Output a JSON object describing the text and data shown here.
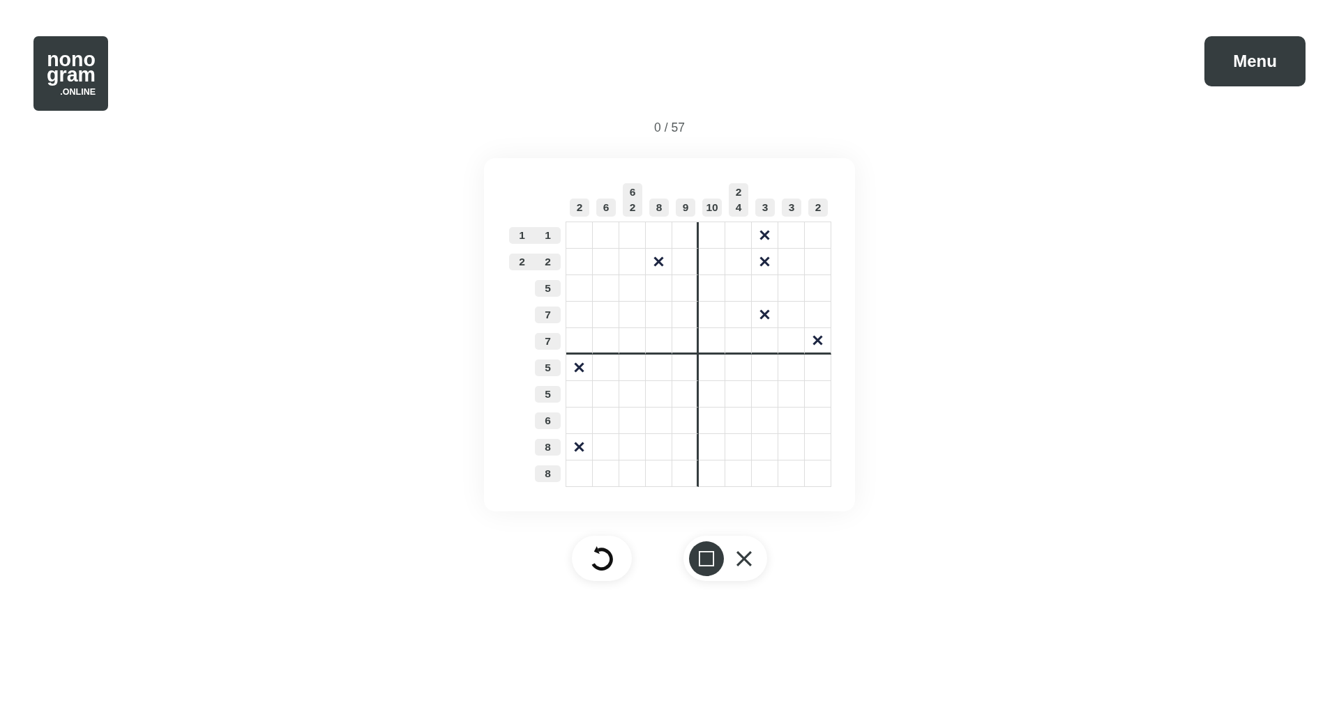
{
  "logo": {
    "wordmark": [
      "nono",
      "gram"
    ],
    "suffix": ".ONLINE"
  },
  "menu_button": {
    "label": "Menu"
  },
  "progress": "0 / 57",
  "puzzle": {
    "columns": [
      {
        "clues": [
          "2"
        ]
      },
      {
        "clues": [
          "6"
        ]
      },
      {
        "clues": [
          "6",
          "2"
        ]
      },
      {
        "clues": [
          "8"
        ]
      },
      {
        "clues": [
          "9"
        ]
      },
      {
        "clues": [
          "10"
        ]
      },
      {
        "clues": [
          "2",
          "4"
        ]
      },
      {
        "clues": [
          "3"
        ]
      },
      {
        "clues": [
          "3"
        ]
      },
      {
        "clues": [
          "2"
        ]
      }
    ],
    "rows": [
      {
        "clues": [
          "1",
          "1"
        ],
        "cells": [
          {
            "crossed": false
          },
          {
            "crossed": false
          },
          {
            "crossed": false
          },
          {
            "crossed": false
          },
          {
            "crossed": false
          },
          {
            "crossed": false
          },
          {
            "crossed": false
          },
          {
            "crossed": true
          },
          {
            "crossed": false
          },
          {
            "crossed": false
          }
        ]
      },
      {
        "clues": [
          "2",
          "2"
        ],
        "cells": [
          {
            "crossed": false
          },
          {
            "crossed": false
          },
          {
            "crossed": false
          },
          {
            "crossed": true
          },
          {
            "crossed": false
          },
          {
            "crossed": false
          },
          {
            "crossed": false
          },
          {
            "crossed": true
          },
          {
            "crossed": false
          },
          {
            "crossed": false
          }
        ]
      },
      {
        "clues": [
          "5"
        ],
        "cells": [
          {
            "crossed": false
          },
          {
            "crossed": false
          },
          {
            "crossed": false
          },
          {
            "crossed": false
          },
          {
            "crossed": false
          },
          {
            "crossed": false
          },
          {
            "crossed": false
          },
          {
            "crossed": false
          },
          {
            "crossed": false
          },
          {
            "crossed": false
          }
        ]
      },
      {
        "clues": [
          "7"
        ],
        "cells": [
          {
            "crossed": false
          },
          {
            "crossed": false
          },
          {
            "crossed": false
          },
          {
            "crossed": false
          },
          {
            "crossed": false
          },
          {
            "crossed": false
          },
          {
            "crossed": false
          },
          {
            "crossed": true
          },
          {
            "crossed": false
          },
          {
            "crossed": false
          }
        ]
      },
      {
        "clues": [
          "7"
        ],
        "cells": [
          {
            "crossed": false
          },
          {
            "crossed": false
          },
          {
            "crossed": false
          },
          {
            "crossed": false
          },
          {
            "crossed": false
          },
          {
            "crossed": false
          },
          {
            "crossed": false
          },
          {
            "crossed": false
          },
          {
            "crossed": false
          },
          {
            "crossed": true
          }
        ]
      },
      {
        "clues": [
          "5"
        ],
        "cells": [
          {
            "crossed": true
          },
          {
            "crossed": false
          },
          {
            "crossed": false
          },
          {
            "crossed": false
          },
          {
            "crossed": false
          },
          {
            "crossed": false
          },
          {
            "crossed": false
          },
          {
            "crossed": false
          },
          {
            "crossed": false
          },
          {
            "crossed": false
          }
        ]
      },
      {
        "clues": [
          "5"
        ],
        "cells": [
          {
            "crossed": false
          },
          {
            "crossed": false
          },
          {
            "crossed": false
          },
          {
            "crossed": false
          },
          {
            "crossed": false
          },
          {
            "crossed": false
          },
          {
            "crossed": false
          },
          {
            "crossed": false
          },
          {
            "crossed": false
          },
          {
            "crossed": false
          }
        ]
      },
      {
        "clues": [
          "6"
        ],
        "cells": [
          {
            "crossed": false
          },
          {
            "crossed": false
          },
          {
            "crossed": false
          },
          {
            "crossed": false
          },
          {
            "crossed": false
          },
          {
            "crossed": false
          },
          {
            "crossed": false
          },
          {
            "crossed": false
          },
          {
            "crossed": false
          },
          {
            "crossed": false
          }
        ]
      },
      {
        "clues": [
          "8"
        ],
        "cells": [
          {
            "crossed": true
          },
          {
            "crossed": false
          },
          {
            "crossed": false
          },
          {
            "crossed": false
          },
          {
            "crossed": false
          },
          {
            "crossed": false
          },
          {
            "crossed": false
          },
          {
            "crossed": false
          },
          {
            "crossed": false
          },
          {
            "crossed": false
          }
        ]
      },
      {
        "clues": [
          "8"
        ],
        "cells": [
          {
            "crossed": false
          },
          {
            "crossed": false
          },
          {
            "crossed": false
          },
          {
            "crossed": false
          },
          {
            "crossed": false
          },
          {
            "crossed": false
          },
          {
            "crossed": false
          },
          {
            "crossed": false
          },
          {
            "crossed": false
          },
          {
            "crossed": false
          }
        ]
      }
    ]
  },
  "modes": [
    {
      "kind": "fill",
      "selected": true
    },
    {
      "kind": "cross",
      "selected": false
    }
  ]
}
